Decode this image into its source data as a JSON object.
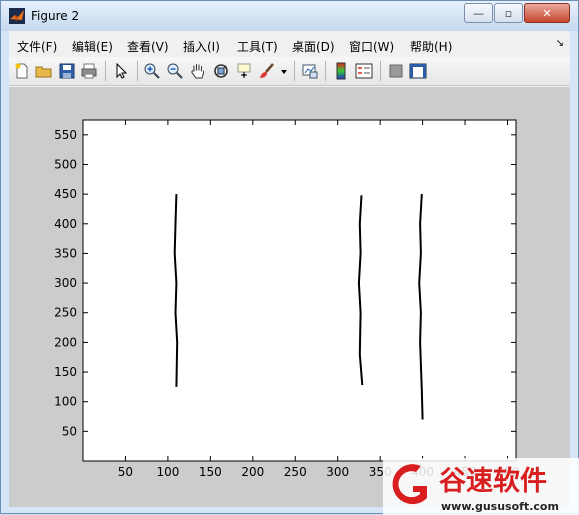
{
  "window": {
    "title": "Figure 2",
    "minimize_glyph": "—",
    "maximize_glyph": "▫",
    "close_glyph": "✕"
  },
  "menubar": {
    "items": [
      "文件(F)",
      "编辑(E)",
      "查看(V)",
      "插入(I)",
      "工具(T)",
      "桌面(D)",
      "窗口(W)",
      "帮助(H)"
    ],
    "dock_glyph": "↘"
  },
  "toolbar": {
    "icons": [
      "new-figure-icon",
      "open-file-icon",
      "save-icon",
      "print-icon",
      "pointer-icon",
      "zoom-in-icon",
      "zoom-out-icon",
      "pan-hand-icon",
      "rotate-3d-icon",
      "data-cursor-icon",
      "brush-icon",
      "brush-dropdown-icon",
      "link-plot-icon",
      "colorbar-icon",
      "legend-icon",
      "hide-plot-tools-icon",
      "show-plot-tools-icon"
    ]
  },
  "chart_data": {
    "type": "line",
    "title": "",
    "xlabel": "",
    "ylabel": "",
    "xlim": [
      0,
      510
    ],
    "ylim": [
      0,
      575
    ],
    "xticks": [
      50,
      100,
      150,
      200,
      250,
      300,
      350,
      400,
      450,
      500
    ],
    "yticks": [
      50,
      100,
      150,
      200,
      250,
      300,
      350,
      400,
      450,
      500,
      550
    ],
    "grid": false,
    "series": [
      {
        "x": [
          110,
          109,
          108,
          110,
          109,
          111,
          110
        ],
        "y": [
          450,
          400,
          350,
          300,
          250,
          200,
          125
        ]
      },
      {
        "x": [
          328,
          326,
          327,
          325,
          327,
          326,
          329
        ],
        "y": [
          448,
          400,
          350,
          300,
          250,
          180,
          128
        ]
      },
      {
        "x": [
          399,
          397,
          398,
          396,
          398,
          397,
          399,
          400
        ],
        "y": [
          450,
          400,
          350,
          300,
          250,
          200,
          120,
          70
        ]
      }
    ]
  },
  "watermark": {
    "brand_cn": "谷速软件",
    "url": "www.gususoft.com"
  }
}
